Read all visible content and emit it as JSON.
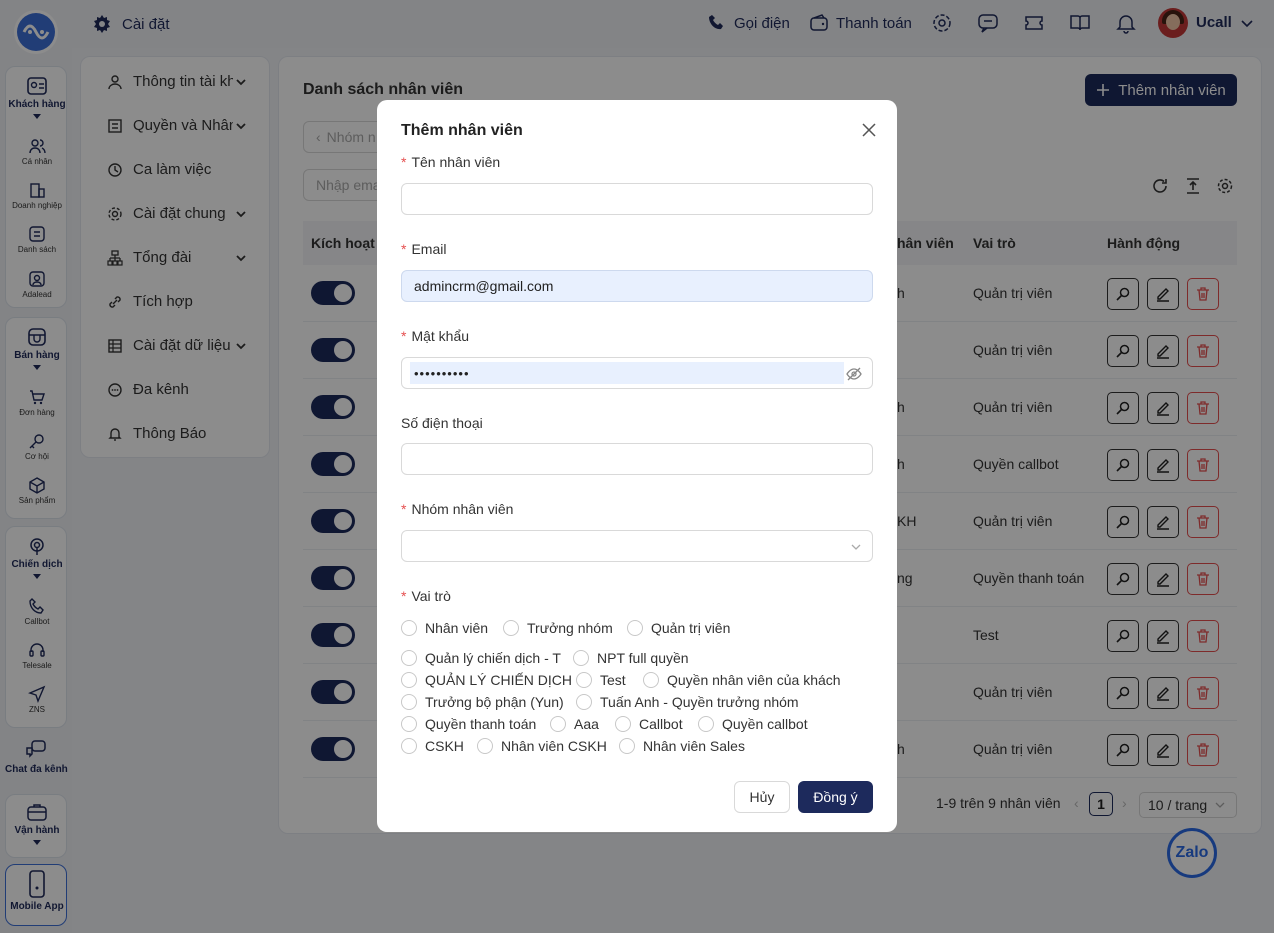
{
  "topbar": {
    "settings_label": "Cài đặt",
    "call_label": "Gọi điện",
    "payment_label": "Thanh toán",
    "user_name": "Ucall"
  },
  "rail": {
    "customers": "Khách hàng",
    "individual": "Cá nhân",
    "business": "Doanh nghiệp",
    "list": "Danh sách",
    "adalead": "Adalead",
    "sales": "Bán hàng",
    "orders": "Đơn hàng",
    "opportunity": "Cơ hội",
    "product": "Sản phẩm",
    "campaign": "Chiến dịch",
    "callbot": "Callbot",
    "telesale": "Telesale",
    "zns": "ZNS",
    "omnichannel": "Chat đa kênh",
    "operation": "Vận hành",
    "mobile": "Mobile App"
  },
  "sidenav": {
    "items": [
      {
        "label": "Thông tin tài khoản",
        "icon": "user-icon",
        "has_chevron": true
      },
      {
        "label": "Quyền và Nhân viên",
        "icon": "list-icon",
        "has_chevron": true
      },
      {
        "label": "Ca làm việc",
        "icon": "clock-icon",
        "has_chevron": false
      },
      {
        "label": "Cài đặt chung",
        "icon": "gear-icon",
        "has_chevron": true
      },
      {
        "label": "Tổng đài",
        "icon": "switchboard-icon",
        "has_chevron": true
      },
      {
        "label": "Tích hợp",
        "icon": "link-icon",
        "has_chevron": false
      },
      {
        "label": "Cài đặt dữ liệu",
        "icon": "database-icon",
        "has_chevron": true
      },
      {
        "label": "Đa kênh",
        "icon": "chat-icon",
        "has_chevron": false
      },
      {
        "label": "Thông Báo",
        "icon": "bell-icon",
        "has_chevron": false
      }
    ]
  },
  "main": {
    "title": "Danh sách nhân viên",
    "add_button": "Thêm nhân viên",
    "group_filter_placeholder": "Nhóm n",
    "email_filter_placeholder": "Nhập ema",
    "columns": {
      "active": "Kích hoạt",
      "staff_fragment": "hân viên",
      "role": "Vai trò",
      "action": "Hành động"
    },
    "rows": [
      {
        "active": true,
        "group_fragment": "h",
        "role": "Quản trị viên"
      },
      {
        "active": true,
        "group_fragment": "",
        "role": "Quản trị viên"
      },
      {
        "active": true,
        "group_fragment": "h",
        "role": "Quản trị viên"
      },
      {
        "active": true,
        "group_fragment": "h",
        "role": "Quyền callbot"
      },
      {
        "active": true,
        "group_fragment": "KH",
        "role": "Quản trị viên"
      },
      {
        "active": true,
        "group_fragment": "ng",
        "role": "Quyền thanh toán"
      },
      {
        "active": true,
        "group_fragment": "",
        "role": "Test"
      },
      {
        "active": true,
        "group_fragment": "",
        "role": "Quản trị viên"
      },
      {
        "active": true,
        "group_fragment": "h",
        "role": "Quản trị viên"
      }
    ],
    "pagination": {
      "summary": "1-9 trên 9 nhân viên",
      "current_page": "1",
      "page_size": "10 / trang"
    }
  },
  "modal": {
    "title": "Thêm nhân viên",
    "fields": {
      "name": {
        "label": "Tên nhân viên",
        "required": true,
        "value": ""
      },
      "email": {
        "label": "Email",
        "required": true,
        "value": "admincrm@gmail.com"
      },
      "password": {
        "label": "Mật khẩu",
        "required": true,
        "value": "••••••••••"
      },
      "phone": {
        "label": "Số điện thoại",
        "required": false,
        "value": ""
      },
      "group": {
        "label": "Nhóm nhân viên",
        "required": true,
        "value": ""
      },
      "role": {
        "label": "Vai trò",
        "required": true
      }
    },
    "roles": [
      "Nhân viên",
      "Trưởng nhóm",
      "Quản trị viên",
      "Quản lý chiến dịch - T",
      "NPT full quyền",
      "QUẢN LÝ CHIẾN DỊCH",
      "Test",
      "Quyền nhân viên của khách",
      "Trưởng bộ phận (Yun)",
      "Tuấn Anh - Quyền trưởng nhóm",
      "Quyền thanh toán",
      "Aaa",
      "Callbot",
      "Quyền callbot",
      "CSKH",
      "Nhân viên CSKH",
      "Nhân viên Sales"
    ],
    "cancel_label": "Hủy",
    "ok_label": "Đồng ý"
  },
  "zalo_label": "Zalo",
  "colors": {
    "primary": "#1d2a5c",
    "danger": "#e54f4f",
    "autofill": "#e8f0fe"
  }
}
